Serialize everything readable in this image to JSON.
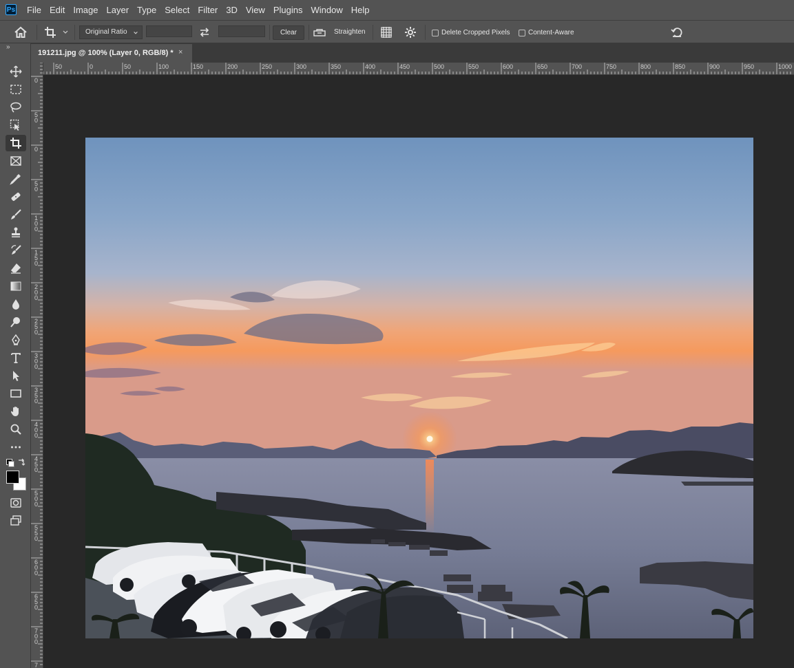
{
  "app": {
    "logo_text": "Ps"
  },
  "menu": {
    "items": [
      "File",
      "Edit",
      "Image",
      "Layer",
      "Type",
      "Select",
      "Filter",
      "3D",
      "View",
      "Plugins",
      "Window",
      "Help"
    ]
  },
  "options_bar": {
    "ratio_select": "Original Ratio",
    "width_value": "",
    "height_value": "",
    "clear_label": "Clear",
    "straighten_label": "Straighten",
    "delete_cropped_label": "Delete Cropped Pixels",
    "delete_cropped_checked": false,
    "content_aware_label": "Content-Aware",
    "content_aware_checked": false
  },
  "document_tab": {
    "title": "191211.jpg @ 100% (Layer 0, RGB/8) *",
    "close": "×"
  },
  "ruler": {
    "horizontal": [
      "50",
      "0",
      "50",
      "100",
      "150",
      "200",
      "250",
      "300",
      "350",
      "400",
      "450",
      "500",
      "550",
      "600",
      "650",
      "700",
      "750",
      "800",
      "850",
      "900",
      "950",
      "1000"
    ],
    "vertical": [
      "0",
      "5 0",
      "0",
      "5 0",
      "1 0 0",
      "1 5 0",
      "2 0 0",
      "2 5 0",
      "3 0 0",
      "3 5 0",
      "4 0 0",
      "4 5 0",
      "5 0 0",
      "5 5 0",
      "6 0 0",
      "6 5 0",
      "7 0 0",
      "7 5 0"
    ]
  },
  "toolbar": {
    "collapse_label": "»",
    "tools": [
      "move-tool",
      "marquee-tool",
      "lasso-tool",
      "object-select-tool",
      "crop-tool",
      "frame-tool",
      "eyedropper-tool",
      "healing-brush-tool",
      "brush-tool",
      "clone-stamp-tool",
      "history-brush-tool",
      "eraser-tool",
      "gradient-tool",
      "blur-tool",
      "dodge-tool",
      "pen-tool",
      "type-tool",
      "path-select-tool",
      "rectangle-tool",
      "hand-tool",
      "zoom-tool",
      "more-tools"
    ],
    "active_tool": "crop-tool",
    "foreground_color": "#000000",
    "background_color": "#ffffff"
  },
  "colors": {
    "panel": "#535353",
    "workspace": "#282828",
    "tab_strip": "#3a3a3a"
  }
}
